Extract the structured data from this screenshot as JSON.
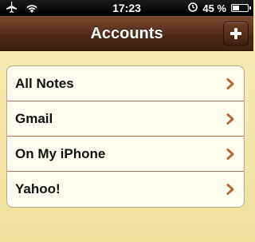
{
  "status_bar": {
    "time": "17:23",
    "battery_percent": "45 %",
    "battery_level": 0.45,
    "icons": [
      "airplane-icon",
      "wifi-icon",
      "alarm-icon",
      "battery-icon"
    ]
  },
  "nav_bar": {
    "title": "Accounts",
    "add_button_icon": "plus-icon"
  },
  "accounts": [
    {
      "label": "All Notes"
    },
    {
      "label": "Gmail"
    },
    {
      "label": "On My iPhone"
    },
    {
      "label": "Yahoo!"
    }
  ],
  "colors": {
    "nav_bar": "#5a3220",
    "paper": "#f3e6a0",
    "chevron": "#b8683a",
    "divider": "#b8704a"
  }
}
